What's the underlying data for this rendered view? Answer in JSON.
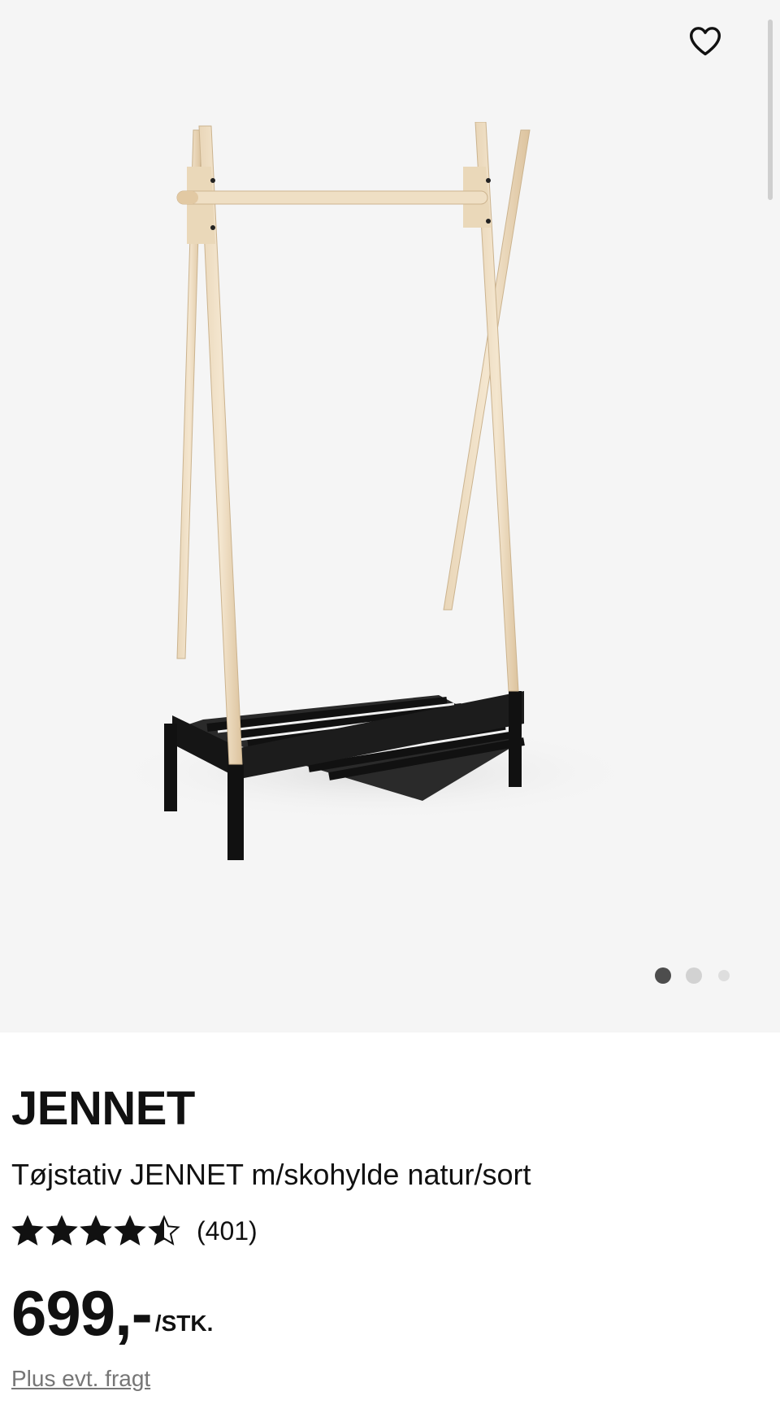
{
  "product": {
    "brand": "JENNET",
    "description": "Tøjstativ JENNET m/skohylde natur/sort",
    "rating": 4.5,
    "rating_max": 5,
    "review_count": "(401)",
    "price": "699,-",
    "unit": "/STK.",
    "shipping_link": "Plus evt. fragt"
  },
  "gallery": {
    "current_image": 1,
    "image_count": 3,
    "favorite_icon": "heart-outline-icon"
  },
  "colors": {
    "text": "#111111",
    "muted": "#767676",
    "gallery_bg": "#f5f5f5",
    "active_dot": "#4d4d4d",
    "inactive_dot": "#d2d2d2"
  }
}
